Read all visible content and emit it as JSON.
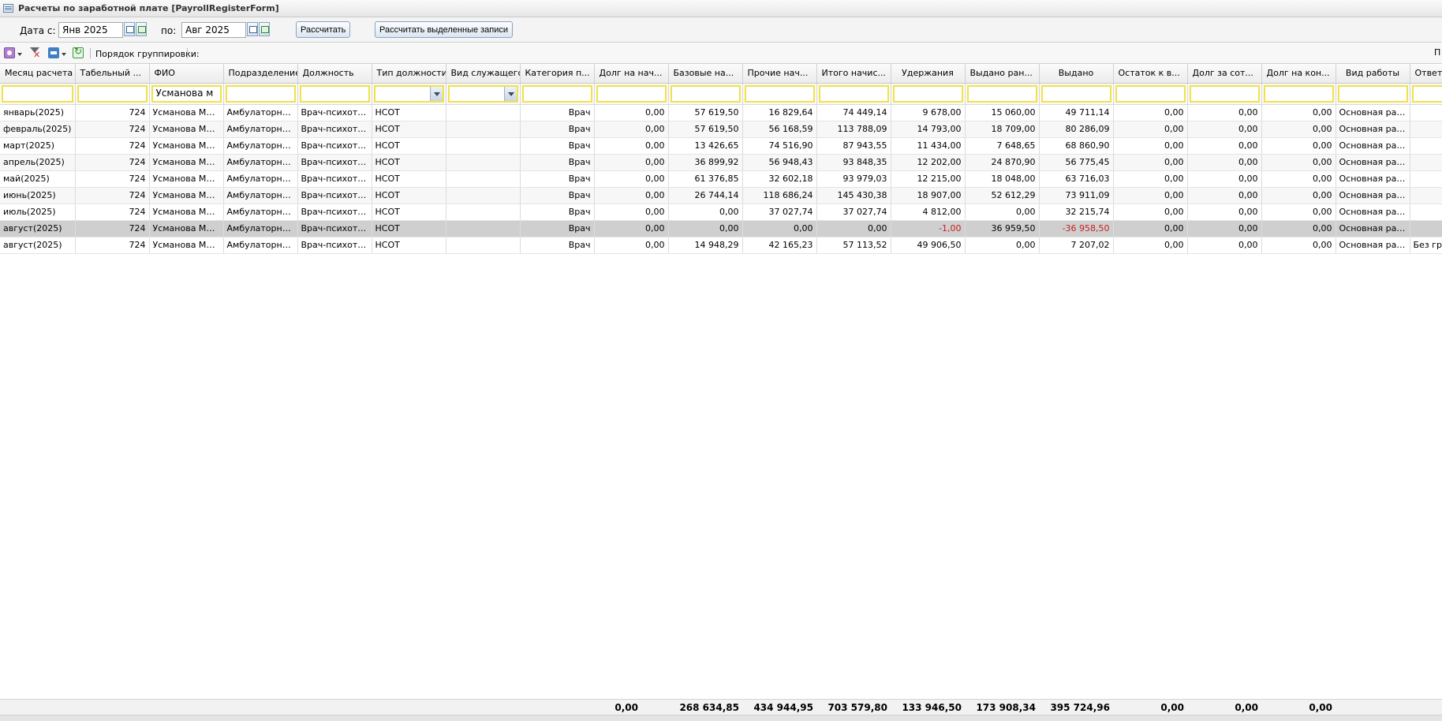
{
  "window": {
    "title": "Расчеты по заработной плате [PayrollRegisterForm]"
  },
  "filters": {
    "date_from_label": "Дата с:",
    "date_from": "Янв 2025",
    "date_to_label": "по:",
    "date_to": "Авг 2025",
    "calc_button": "Рассчитать",
    "calc_selected_button": "Рассчитать выделенные записи"
  },
  "toolbar": {
    "group_order_label": "Порядок группировки:",
    "right_label": "П"
  },
  "columns": [
    "Месяц расчета",
    "Табельный ...",
    "ФИО",
    "Подразделение",
    "Должность",
    "Тип должности",
    "Вид служащего",
    "Категория п...",
    "Долг на нач...",
    "Базовые на...",
    "Прочие нач...",
    "Итого начис...",
    "Удержания",
    "Выдано ран...",
    "Выдано",
    "Остаток к в...",
    "Долг за сот...",
    "Долг на кон...",
    "Вид работы",
    "Ответс"
  ],
  "filter_values": {
    "fio": "Усманова м"
  },
  "rows": [
    [
      "январь(2025)",
      "724",
      "Усманова Мар...",
      "Амбулаторное...",
      "Врач-психотер...",
      "НСОТ",
      "",
      "Врач",
      "0,00",
      "57 619,50",
      "16 829,64",
      "74 449,14",
      "9 678,00",
      "15 060,00",
      "49 711,14",
      "0,00",
      "0,00",
      "0,00",
      "Основная раб...",
      ""
    ],
    [
      "февраль(2025)",
      "724",
      "Усманова Мар...",
      "Амбулаторное...",
      "Врач-психотер...",
      "НСОТ",
      "",
      "Врач",
      "0,00",
      "57 619,50",
      "56 168,59",
      "113 788,09",
      "14 793,00",
      "18 709,00",
      "80 286,09",
      "0,00",
      "0,00",
      "0,00",
      "Основная раб...",
      ""
    ],
    [
      "март(2025)",
      "724",
      "Усманова Мар...",
      "Амбулаторное...",
      "Врач-психотер...",
      "НСОТ",
      "",
      "Врач",
      "0,00",
      "13 426,65",
      "74 516,90",
      "87 943,55",
      "11 434,00",
      "7 648,65",
      "68 860,90",
      "0,00",
      "0,00",
      "0,00",
      "Основная раб...",
      ""
    ],
    [
      "апрель(2025)",
      "724",
      "Усманова Мар...",
      "Амбулаторное...",
      "Врач-психотер...",
      "НСОТ",
      "",
      "Врач",
      "0,00",
      "36 899,92",
      "56 948,43",
      "93 848,35",
      "12 202,00",
      "24 870,90",
      "56 775,45",
      "0,00",
      "0,00",
      "0,00",
      "Основная раб...",
      ""
    ],
    [
      "май(2025)",
      "724",
      "Усманова Мар...",
      "Амбулаторное...",
      "Врач-психотер...",
      "НСОТ",
      "",
      "Врач",
      "0,00",
      "61 376,85",
      "32 602,18",
      "93 979,03",
      "12 215,00",
      "18 048,00",
      "63 716,03",
      "0,00",
      "0,00",
      "0,00",
      "Основная раб...",
      ""
    ],
    [
      "июнь(2025)",
      "724",
      "Усманова Мар...",
      "Амбулаторное...",
      "Врач-психотер...",
      "НСОТ",
      "",
      "Врач",
      "0,00",
      "26 744,14",
      "118 686,24",
      "145 430,38",
      "18 907,00",
      "52 612,29",
      "73 911,09",
      "0,00",
      "0,00",
      "0,00",
      "Основная раб...",
      ""
    ],
    [
      "июль(2025)",
      "724",
      "Усманова Мар...",
      "Амбулаторное...",
      "Врач-психотер...",
      "НСОТ",
      "",
      "Врач",
      "0,00",
      "0,00",
      "37 027,74",
      "37 027,74",
      "4 812,00",
      "0,00",
      "32 215,74",
      "0,00",
      "0,00",
      "0,00",
      "Основная раб...",
      ""
    ],
    [
      "август(2025)",
      "724",
      "Усманова Мар...",
      "Амбулаторное...",
      "Врач-психотер...",
      "НСОТ",
      "",
      "Врач",
      "0,00",
      "0,00",
      "0,00",
      "0,00",
      "-1,00",
      "36 959,50",
      "-36 958,50",
      "0,00",
      "0,00",
      "0,00",
      "Основная раб...",
      ""
    ],
    [
      "август(2025)",
      "724",
      "Усманова Мар...",
      "Амбулаторное...",
      "Врач-психотер...",
      "НСОТ",
      "",
      "Врач",
      "0,00",
      "14 948,29",
      "42 165,23",
      "57 113,52",
      "49 906,50",
      "0,00",
      "7 207,02",
      "0,00",
      "0,00",
      "0,00",
      "Основная раб...",
      "Без гру"
    ]
  ],
  "selected_row": 7,
  "totals": [
    "0,00",
    "268 634,85",
    "434 944,95",
    "703 579,80",
    "133 946,50",
    "173 908,34",
    "395 724,96",
    "0,00",
    "0,00",
    "0,00"
  ],
  "colors": {
    "filter_border": "#f0e24a",
    "negative": "#c81e1e",
    "selected_row": "#cfcfcf"
  }
}
